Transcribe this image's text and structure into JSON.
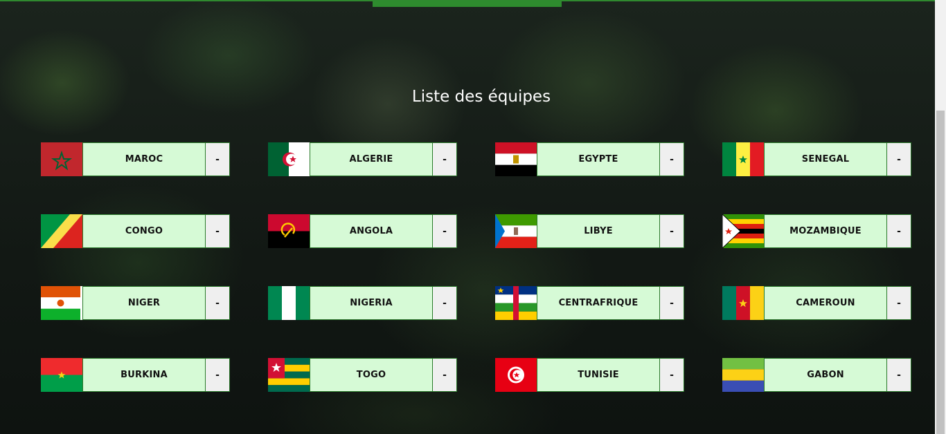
{
  "page": {
    "title": "Liste des équipes"
  },
  "teams": [
    {
      "name": "MAROC",
      "score": "-",
      "flag": "morocco-flag-icon"
    },
    {
      "name": "ALGERIE",
      "score": "-",
      "flag": "algeria-flag-icon"
    },
    {
      "name": "EGYPTE",
      "score": "-",
      "flag": "egypt-flag-icon"
    },
    {
      "name": "SENEGAL",
      "score": "-",
      "flag": "senegal-flag-icon"
    },
    {
      "name": "CONGO",
      "score": "-",
      "flag": "congo-flag-icon"
    },
    {
      "name": "ANGOLA",
      "score": "-",
      "flag": "angola-flag-icon"
    },
    {
      "name": "LIBYE",
      "score": "-",
      "flag": "equatorial-guinea-flag-icon"
    },
    {
      "name": "MOZAMBIQUE",
      "score": "-",
      "flag": "zimbabwe-flag-icon"
    },
    {
      "name": "NIGER",
      "score": "-",
      "flag": "niger-flag-icon"
    },
    {
      "name": "NIGERIA",
      "score": "-",
      "flag": "nigeria-flag-icon"
    },
    {
      "name": "CENTRAFRIQUE",
      "score": "-",
      "flag": "central-african-republic-flag-icon"
    },
    {
      "name": "CAMEROUN",
      "score": "-",
      "flag": "cameroon-flag-icon"
    },
    {
      "name": "BURKINA",
      "score": "-",
      "flag": "burkina-faso-flag-icon"
    },
    {
      "name": "TOGO",
      "score": "-",
      "flag": "togo-flag-icon"
    },
    {
      "name": "TUNISIE",
      "score": "-",
      "flag": "tunisia-flag-icon"
    },
    {
      "name": "GABON",
      "score": "-",
      "flag": "gabon-flag-icon"
    }
  ],
  "colors": {
    "accent": "#2e8b2e",
    "name_bg": "#d6fad6",
    "score_bg": "#efefef",
    "title": "#ffffff"
  }
}
